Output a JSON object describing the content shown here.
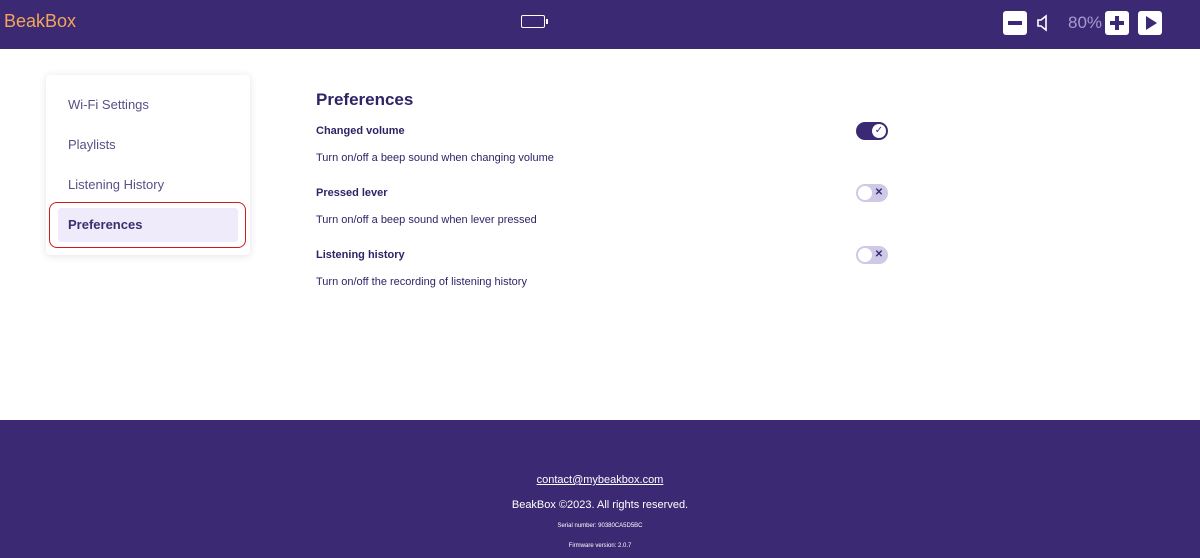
{
  "header": {
    "logo_text": "BeakBox",
    "volume_level": "80%"
  },
  "sidebar": {
    "items": [
      {
        "label": "Wi-Fi Settings"
      },
      {
        "label": "Playlists"
      },
      {
        "label": "Listening History"
      },
      {
        "label": "Preferences",
        "active": true
      }
    ]
  },
  "main": {
    "title": "Preferences",
    "preferences": [
      {
        "title": "Changed volume",
        "description": "Turn on/off a beep sound when changing volume",
        "enabled": true
      },
      {
        "title": "Pressed lever",
        "description": "Turn on/off a beep sound when lever pressed",
        "enabled": false
      },
      {
        "title": "Listening history",
        "description": "Turn on/off the recording of listening history",
        "enabled": false
      }
    ]
  },
  "footer": {
    "email": "contact@mybeakbox.com",
    "copyright": "BeakBox ©2023. All rights reserved.",
    "serial": "Serial number: 90380CA5D5BC",
    "firmware": "Firmware version: 2.0.7"
  },
  "colors": {
    "primary": "#3b2a73",
    "accent": "#f2a55b",
    "toggle_off": "#cfc8e6",
    "highlight": "#d11a1a"
  },
  "icons": {
    "battery": "battery-icon",
    "minus": "minus-icon",
    "speaker": "speaker-icon",
    "plus": "plus-icon",
    "play": "play-icon",
    "check": "check-icon",
    "cross": "cross-icon"
  }
}
